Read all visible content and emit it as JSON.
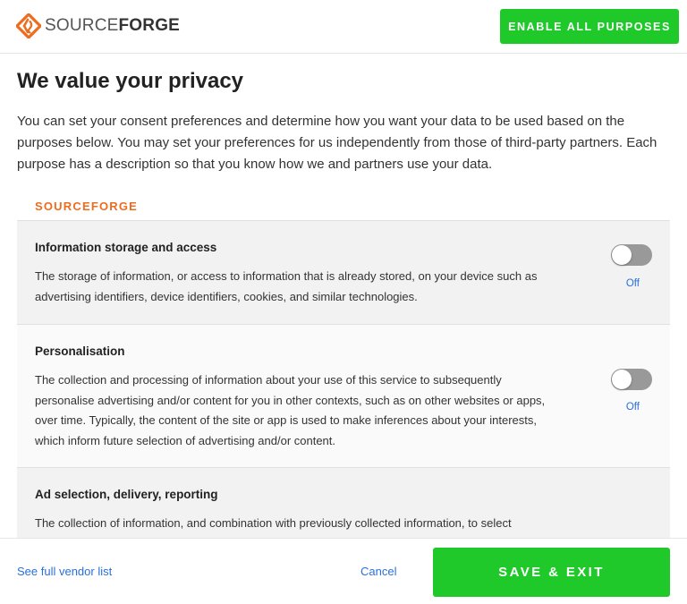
{
  "header": {
    "logo_light": "SOURCE",
    "logo_bold": "FORGE",
    "enable_all_label": "ENABLE ALL PURPOSES"
  },
  "main": {
    "title": "We value your privacy",
    "intro": "You can set your consent preferences and determine how you want your data to be used based on the purposes below. You may set your preferences for us independently from those of third-party partners. Each purpose has a description so that you know how we and partners use your data.",
    "section_label": "SOURCEFORGE",
    "purposes": [
      {
        "title": "Information storage and access",
        "description": "The storage of information, or access to information that is already stored, on your device such as advertising identifiers, device identifiers, cookies, and similar technologies.",
        "state": "Off"
      },
      {
        "title": "Personalisation",
        "description": "The collection and processing of information about your use of this service to subsequently personalise advertising and/or content for you in other contexts, such as on other websites or apps, over time. Typically, the content of the site or app is used to make inferences about your interests, which inform future selection of advertising and/or content.",
        "state": "Off"
      },
      {
        "title": "Ad selection, delivery, reporting",
        "description": "The collection of information, and combination with previously collected information, to select"
      }
    ]
  },
  "footer": {
    "vendor_link": "See full vendor list",
    "cancel_label": "Cancel",
    "save_label": "SAVE & EXIT"
  },
  "colors": {
    "accent_green": "#1ec929",
    "brand_orange": "#ee6c1d",
    "link_blue": "#2a6fdb",
    "toggle_off": "#999999"
  },
  "icons": {
    "logo": "sourceforge-diamond-logo-icon"
  }
}
